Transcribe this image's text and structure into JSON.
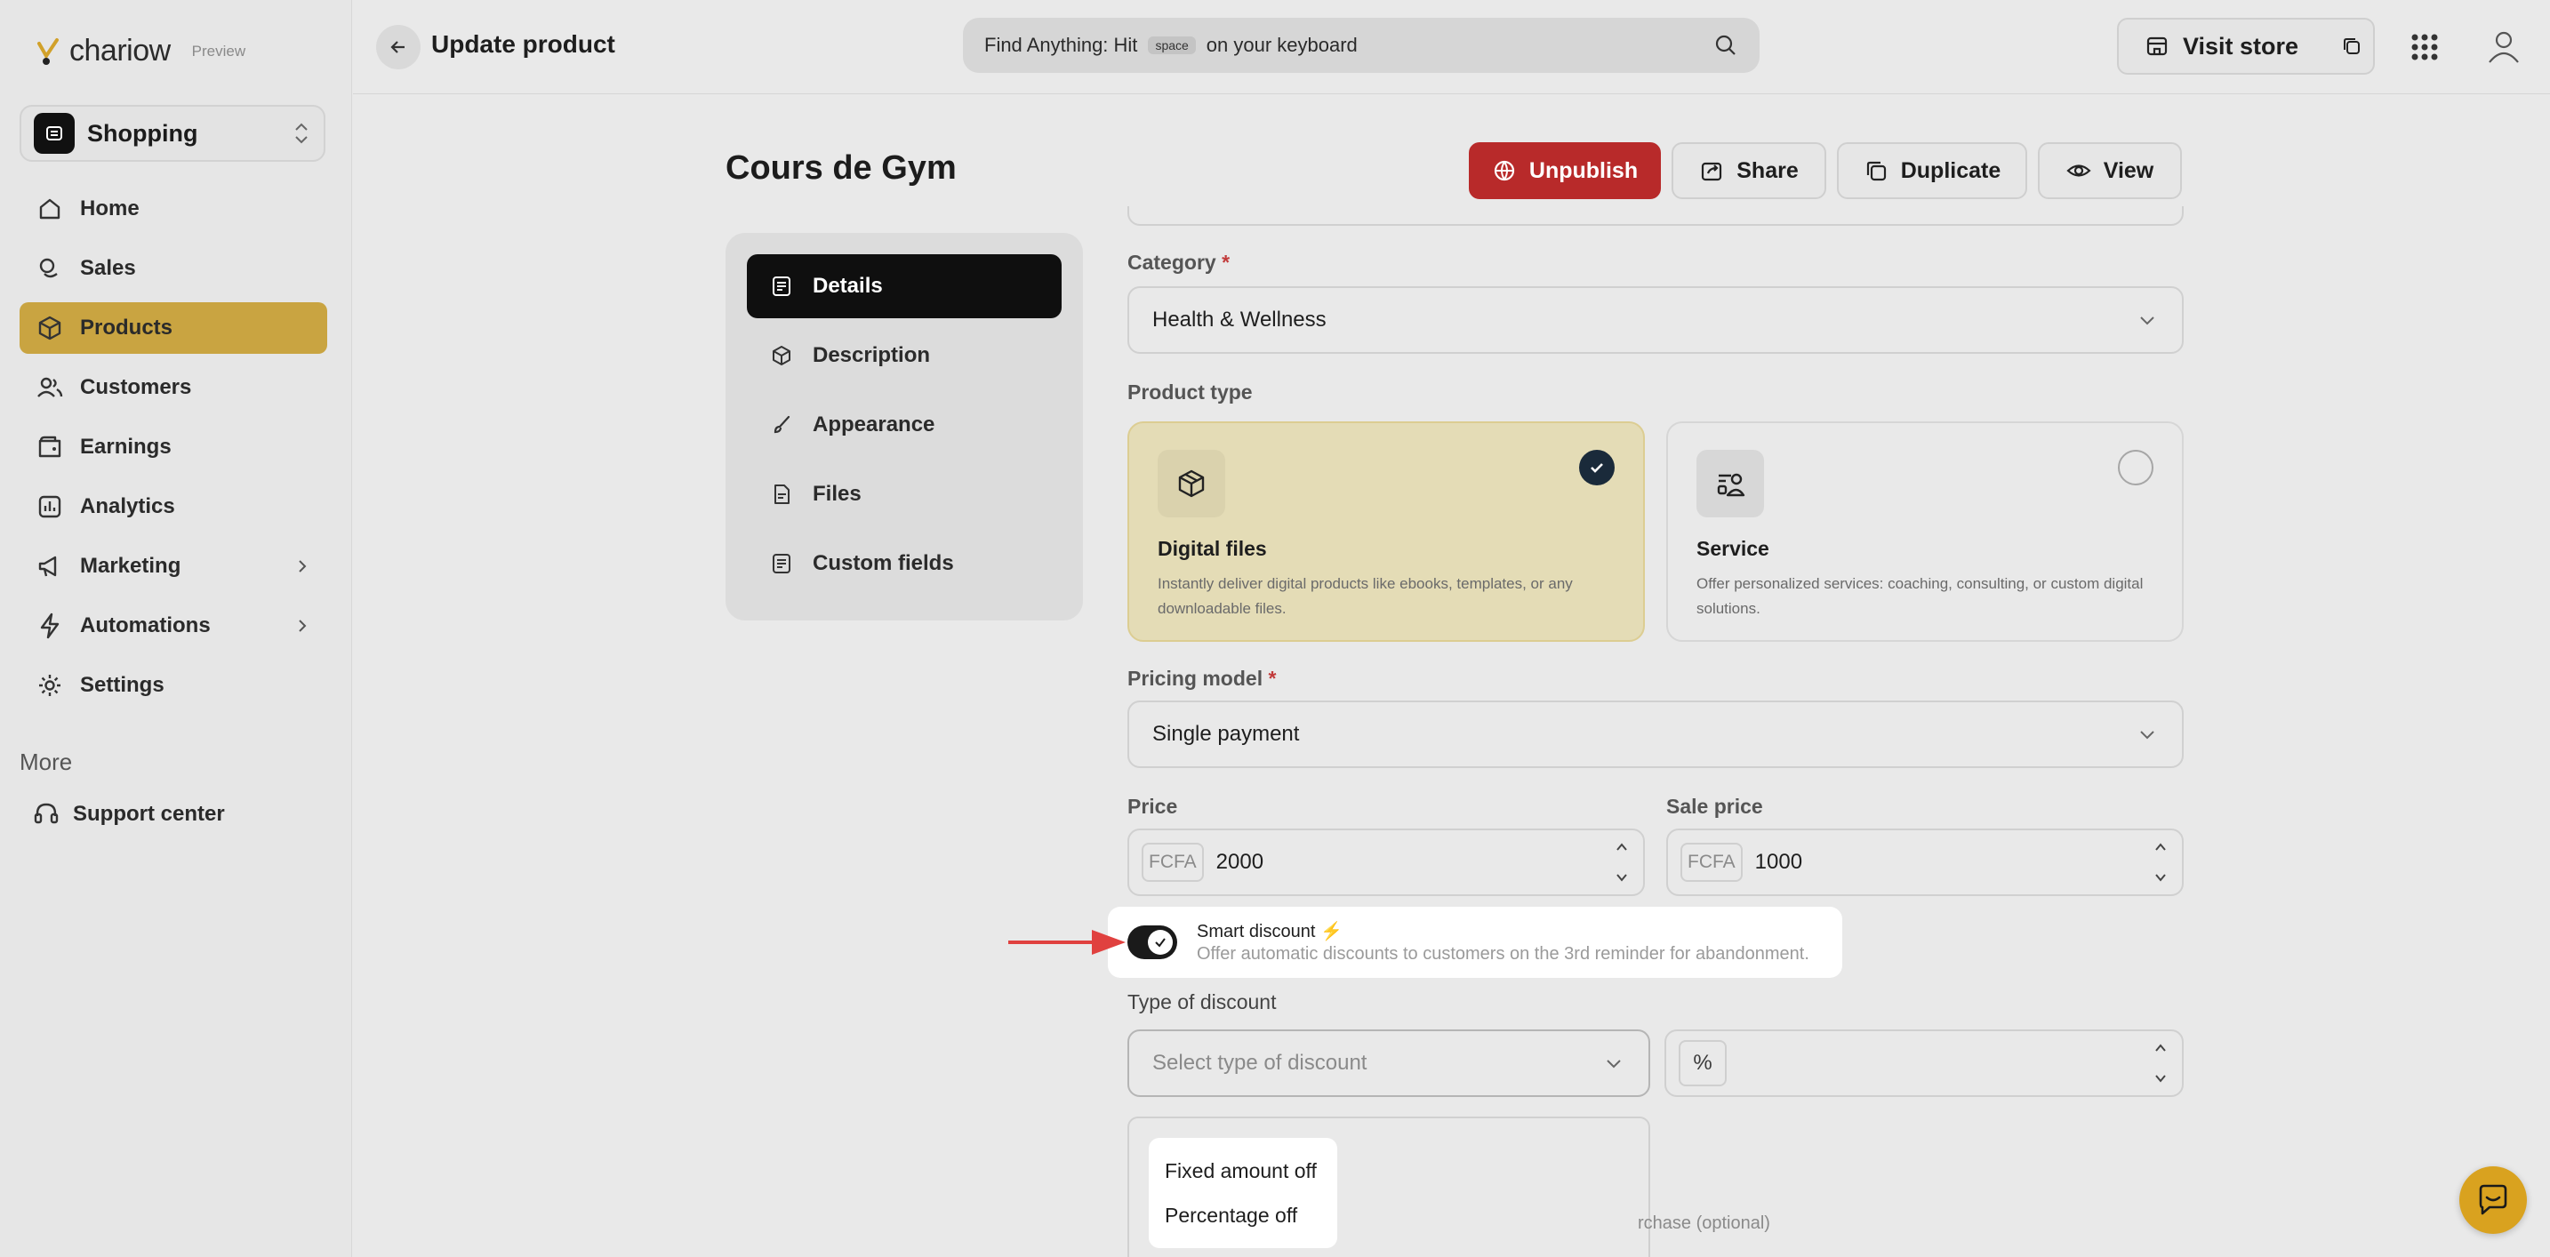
{
  "brand": {
    "name": "chariow",
    "badge": "Preview"
  },
  "store": {
    "name": "Shopping"
  },
  "sidebar": {
    "items": [
      {
        "label": "Home",
        "icon": "home-icon"
      },
      {
        "label": "Sales",
        "icon": "coins-icon"
      },
      {
        "label": "Products",
        "icon": "box-icon",
        "active": true
      },
      {
        "label": "Customers",
        "icon": "users-icon"
      },
      {
        "label": "Earnings",
        "icon": "wallet-icon"
      },
      {
        "label": "Analytics",
        "icon": "chart-icon"
      },
      {
        "label": "Marketing",
        "icon": "megaphone-icon"
      },
      {
        "label": "Automations",
        "icon": "lightning-icon"
      },
      {
        "label": "Settings",
        "icon": "gear-icon"
      }
    ],
    "more_title": "More",
    "support_label": "Support center"
  },
  "topbar": {
    "title": "Update product",
    "search_prefix": "Find Anything: Hit",
    "search_key": "space",
    "search_suffix": "on your keyboard",
    "visit_store": "Visit store"
  },
  "product": {
    "title": "Cours de Gym",
    "actions": {
      "unpublish": "Unpublish",
      "share": "Share",
      "duplicate": "Duplicate",
      "view": "View"
    }
  },
  "tabs": [
    {
      "label": "Details",
      "active": true
    },
    {
      "label": "Description"
    },
    {
      "label": "Appearance"
    },
    {
      "label": "Files"
    },
    {
      "label": "Custom fields"
    }
  ],
  "form": {
    "category_label": "Category",
    "category_value": "Health & Wellness",
    "product_type_label": "Product type",
    "types": [
      {
        "title": "Digital files",
        "desc": "Instantly deliver digital products like ebooks, templates, or any downloadable files.",
        "selected": true
      },
      {
        "title": "Service",
        "desc": "Offer personalized services: coaching, consulting, or custom digital solutions.",
        "selected": false
      }
    ],
    "pricing_label": "Pricing model",
    "pricing_value": "Single payment",
    "price_label": "Price",
    "price_currency": "FCFA",
    "price_value": "2000",
    "sale_label": "Sale price",
    "sale_currency": "FCFA",
    "sale_value": "1000",
    "smart_title": "Smart discount ⚡",
    "smart_desc": "Offer automatic discounts to customers on the 3rd reminder for abandonment.",
    "discount_type_label": "Type of discount",
    "discount_type_placeholder": "Select type of discount",
    "discount_unit": "%",
    "optional_hint": "rchase (optional)",
    "discount_options": [
      "Fixed amount off",
      "Percentage off"
    ]
  },
  "colors": {
    "accent": "#c9a441",
    "danger": "#b82a2a",
    "fab": "#d9a21f"
  }
}
